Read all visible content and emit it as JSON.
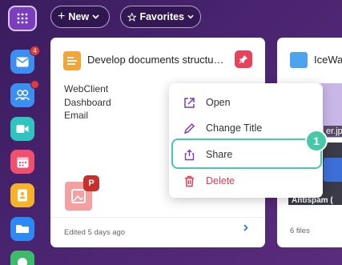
{
  "topbar": {
    "new_label": "New",
    "favorites_label": "Favorites"
  },
  "sidebar": {
    "items": [
      {
        "name": "mail",
        "badge": "4",
        "color": "#3b8ff0"
      },
      {
        "name": "contacts",
        "color": "#3b8ff0"
      },
      {
        "name": "video",
        "color": "#2fc4c0"
      },
      {
        "name": "calendar",
        "color": "#f0506e"
      },
      {
        "name": "address-book",
        "color": "#f6b32a"
      },
      {
        "name": "drive",
        "color": "#2b8af5"
      },
      {
        "name": "tasks",
        "color": "#3dbb6d"
      }
    ]
  },
  "card1": {
    "title": "Develop documents structu…",
    "tags": [
      "WebClient",
      "Dashboard",
      "Email"
    ],
    "file_badge": "P",
    "footer": "Edited 5 days ago",
    "pin_color": "#e8435a"
  },
  "card2": {
    "title": "IceWa",
    "image_label": "er.jp",
    "image2_label": "Antispam (",
    "footer": "6 files"
  },
  "menu": {
    "open": "Open",
    "change_title": "Change Title",
    "share": "Share",
    "delete": "Delete"
  },
  "tutorial": {
    "step": "1",
    "highlight_color": "#46c9a8"
  }
}
